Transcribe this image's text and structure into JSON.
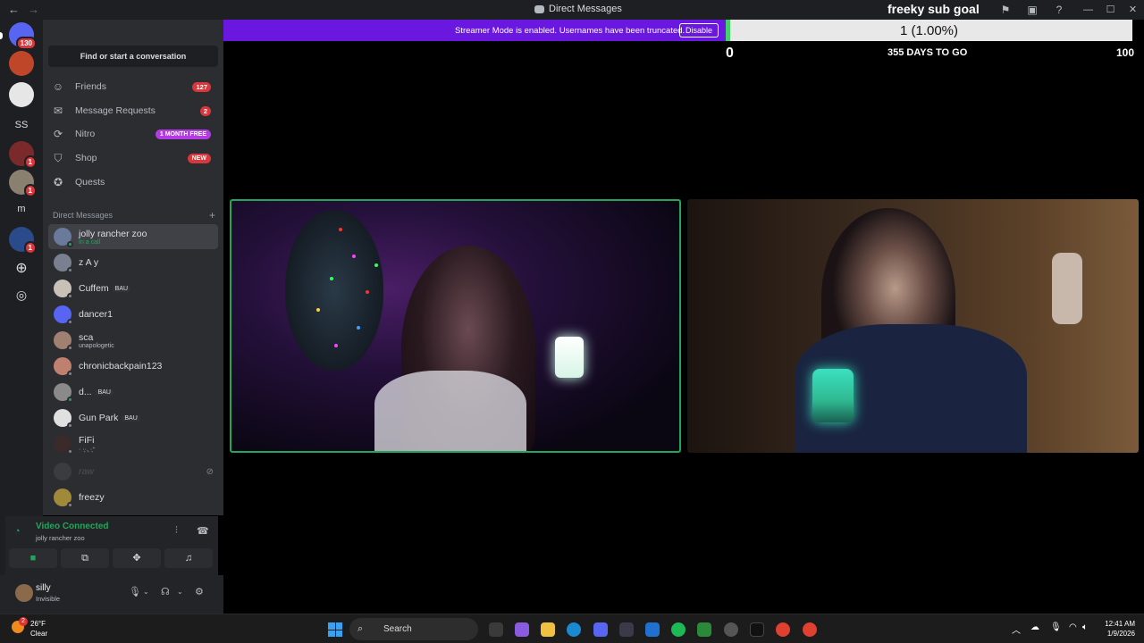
{
  "window": {
    "title": "Direct Messages",
    "back_icon": "←",
    "forward_icon": "→"
  },
  "banner": {
    "text": "Streamer Mode is enabled. Usernames have been truncated.",
    "button": "Disable"
  },
  "goal": {
    "title": "freeky sub goal",
    "current": 1,
    "target": 100,
    "progress_label": "1 (1.00%)",
    "progress_fraction": 0.01,
    "min_label": "0",
    "max_label": "100",
    "days_label": "355 DAYS TO GO"
  },
  "servers": [
    {
      "label": "",
      "badge": "130",
      "color": "#5865f2"
    },
    {
      "label": "",
      "badge": "",
      "color": "#c0462a"
    },
    {
      "label": "",
      "badge": "",
      "color": "#e6e6e6"
    },
    {
      "label": "SS",
      "badge": ""
    },
    {
      "label": "",
      "badge": "1",
      "color": "#7a2a2a"
    },
    {
      "label": "",
      "badge": "1",
      "color": "#8a8070"
    },
    {
      "label": "m",
      "badge": ""
    },
    {
      "label": "",
      "badge": "1",
      "color": "#2a4a8a"
    }
  ],
  "sidebar": {
    "find_label": "Find or start a conversation",
    "nav": [
      {
        "label": "Friends",
        "count": "127"
      },
      {
        "label": "Message Requests",
        "count": "2"
      },
      {
        "label": "Nitro",
        "promo": "1 MONTH FREE"
      },
      {
        "label": "Shop",
        "promo": "NEW"
      },
      {
        "label": "Quests"
      }
    ],
    "dm_header": "Direct Messages",
    "dms": [
      {
        "name": "jolly rancher zoo",
        "sub": "In a call"
      },
      {
        "name": "z A y"
      },
      {
        "name": "Cuffem",
        "tag": "BAU"
      },
      {
        "name": "dancer1"
      },
      {
        "name": "sca",
        "sub": "unapologetic"
      },
      {
        "name": "chronicbackpain123"
      },
      {
        "name": "d...",
        "tag": "BAU"
      },
      {
        "name": "Gun Park",
        "tag": "BAU"
      },
      {
        "name": "FiFi",
        "sub": "· ·͙·.͙ ·͙⁺"
      },
      {
        "name": "raw"
      },
      {
        "name": "freezy"
      }
    ]
  },
  "voice": {
    "status": "Video Connected",
    "channel": "jolly rancher zoo"
  },
  "user": {
    "name": "silly",
    "status": "Invisible"
  },
  "taskbar": {
    "temp": "26°F",
    "condition": "Clear",
    "weather_badge": "2",
    "search": "Search",
    "time": "12:41 AM",
    "date": "1/9/2026"
  },
  "colors": {
    "accent_purple": "#6a17e0",
    "online_green": "#23a55a",
    "badge_red": "#da373c",
    "nitro_pink": "#b23ce2"
  }
}
